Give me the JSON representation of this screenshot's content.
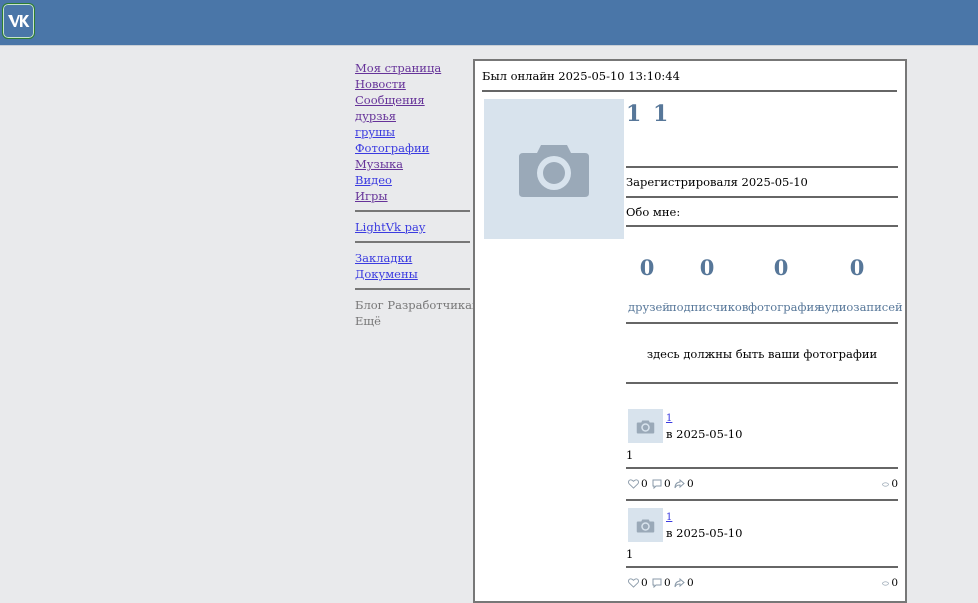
{
  "header": {
    "logo_icon": "vk-logo-icon"
  },
  "menu": {
    "items": [
      {
        "label": "Моя страница",
        "visited": true
      },
      {
        "label": "Новости",
        "visited": true
      },
      {
        "label": "Сообщения",
        "visited": true
      },
      {
        "label": "дурзья",
        "visited": true
      },
      {
        "label": "грушы",
        "visited": false
      },
      {
        "label": "Фотографии",
        "visited": false
      },
      {
        "label": "Музыка",
        "visited": true
      },
      {
        "label": "Видео",
        "visited": false
      },
      {
        "label": "Игры",
        "visited": true
      }
    ],
    "pay": "LightVk pay",
    "bookmarks": "Закладки",
    "documents": "Докумены",
    "blog": "Блог Разработчикам",
    "more": "Ещё"
  },
  "profile": {
    "online": "Был онлайн 2025-05-10 13:10:44",
    "name": "1 1",
    "registered": "Зарегистрироваля 2025-05-10",
    "about": "Обо мне:",
    "counters": [
      {
        "value": "0",
        "label": "друзей"
      },
      {
        "value": "0",
        "label": "подписчиков"
      },
      {
        "value": "0",
        "label": "фотография"
      },
      {
        "value": "0",
        "label": "аудиозаписей"
      }
    ],
    "no_photos": "здесь должны быть ваши фотографии"
  },
  "posts": [
    {
      "author": "1",
      "date": "в 2025-05-10",
      "text": "1",
      "likes": "0",
      "comments": "0",
      "reposts": "0",
      "views": "0"
    },
    {
      "author": "1",
      "date": "в 2025-05-10",
      "text": "1",
      "likes": "0",
      "comments": "0",
      "reposts": "0",
      "views": "0"
    }
  ]
}
